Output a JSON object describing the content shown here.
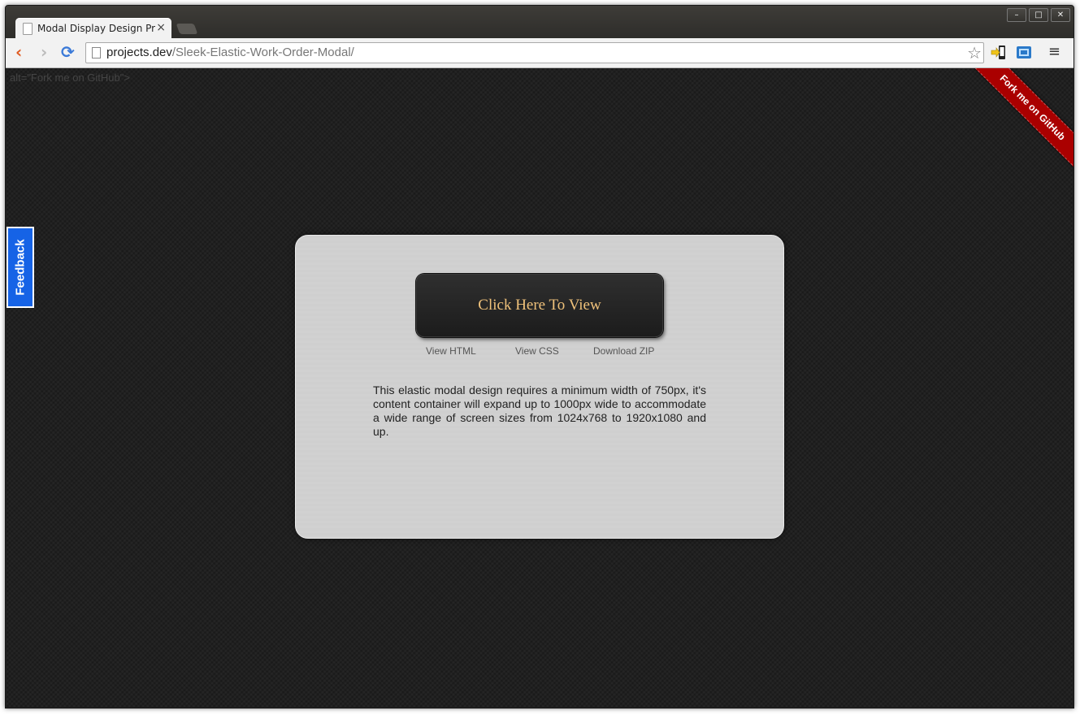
{
  "browser": {
    "tab_title": "Modal Display Design Pre",
    "tab_close": "×",
    "url_host": "projects.dev",
    "url_path": "/Sleek-Elastic-Work-Order-Modal/",
    "window_controls": {
      "minimize": "–",
      "maximize": "□",
      "close": "✕"
    },
    "nav_icons": {
      "back": "‹",
      "forward": "›",
      "reload": "⟳",
      "star": "☆",
      "menu": "≡"
    }
  },
  "page": {
    "stray_text": "alt=\"Fork me on GitHub\">",
    "ribbon_label": "Fork me on GitHub",
    "feedback_label": "Feedback",
    "modal": {
      "button_label": "Click Here To View",
      "links": [
        "View HTML",
        "View CSS",
        "Download ZIP"
      ],
      "description": "This elastic modal design requires a minimum width of 750px, it's content container will expand up to 1000px wide to accommodate a wide range of screen sizes from 1024x768 to 1920x1080 and up."
    }
  },
  "colors": {
    "background": "#202020",
    "modal": "#cfcfcf",
    "button_text": "#efc17a",
    "ribbon": "#aa0000",
    "feedback": "#1663e6"
  }
}
